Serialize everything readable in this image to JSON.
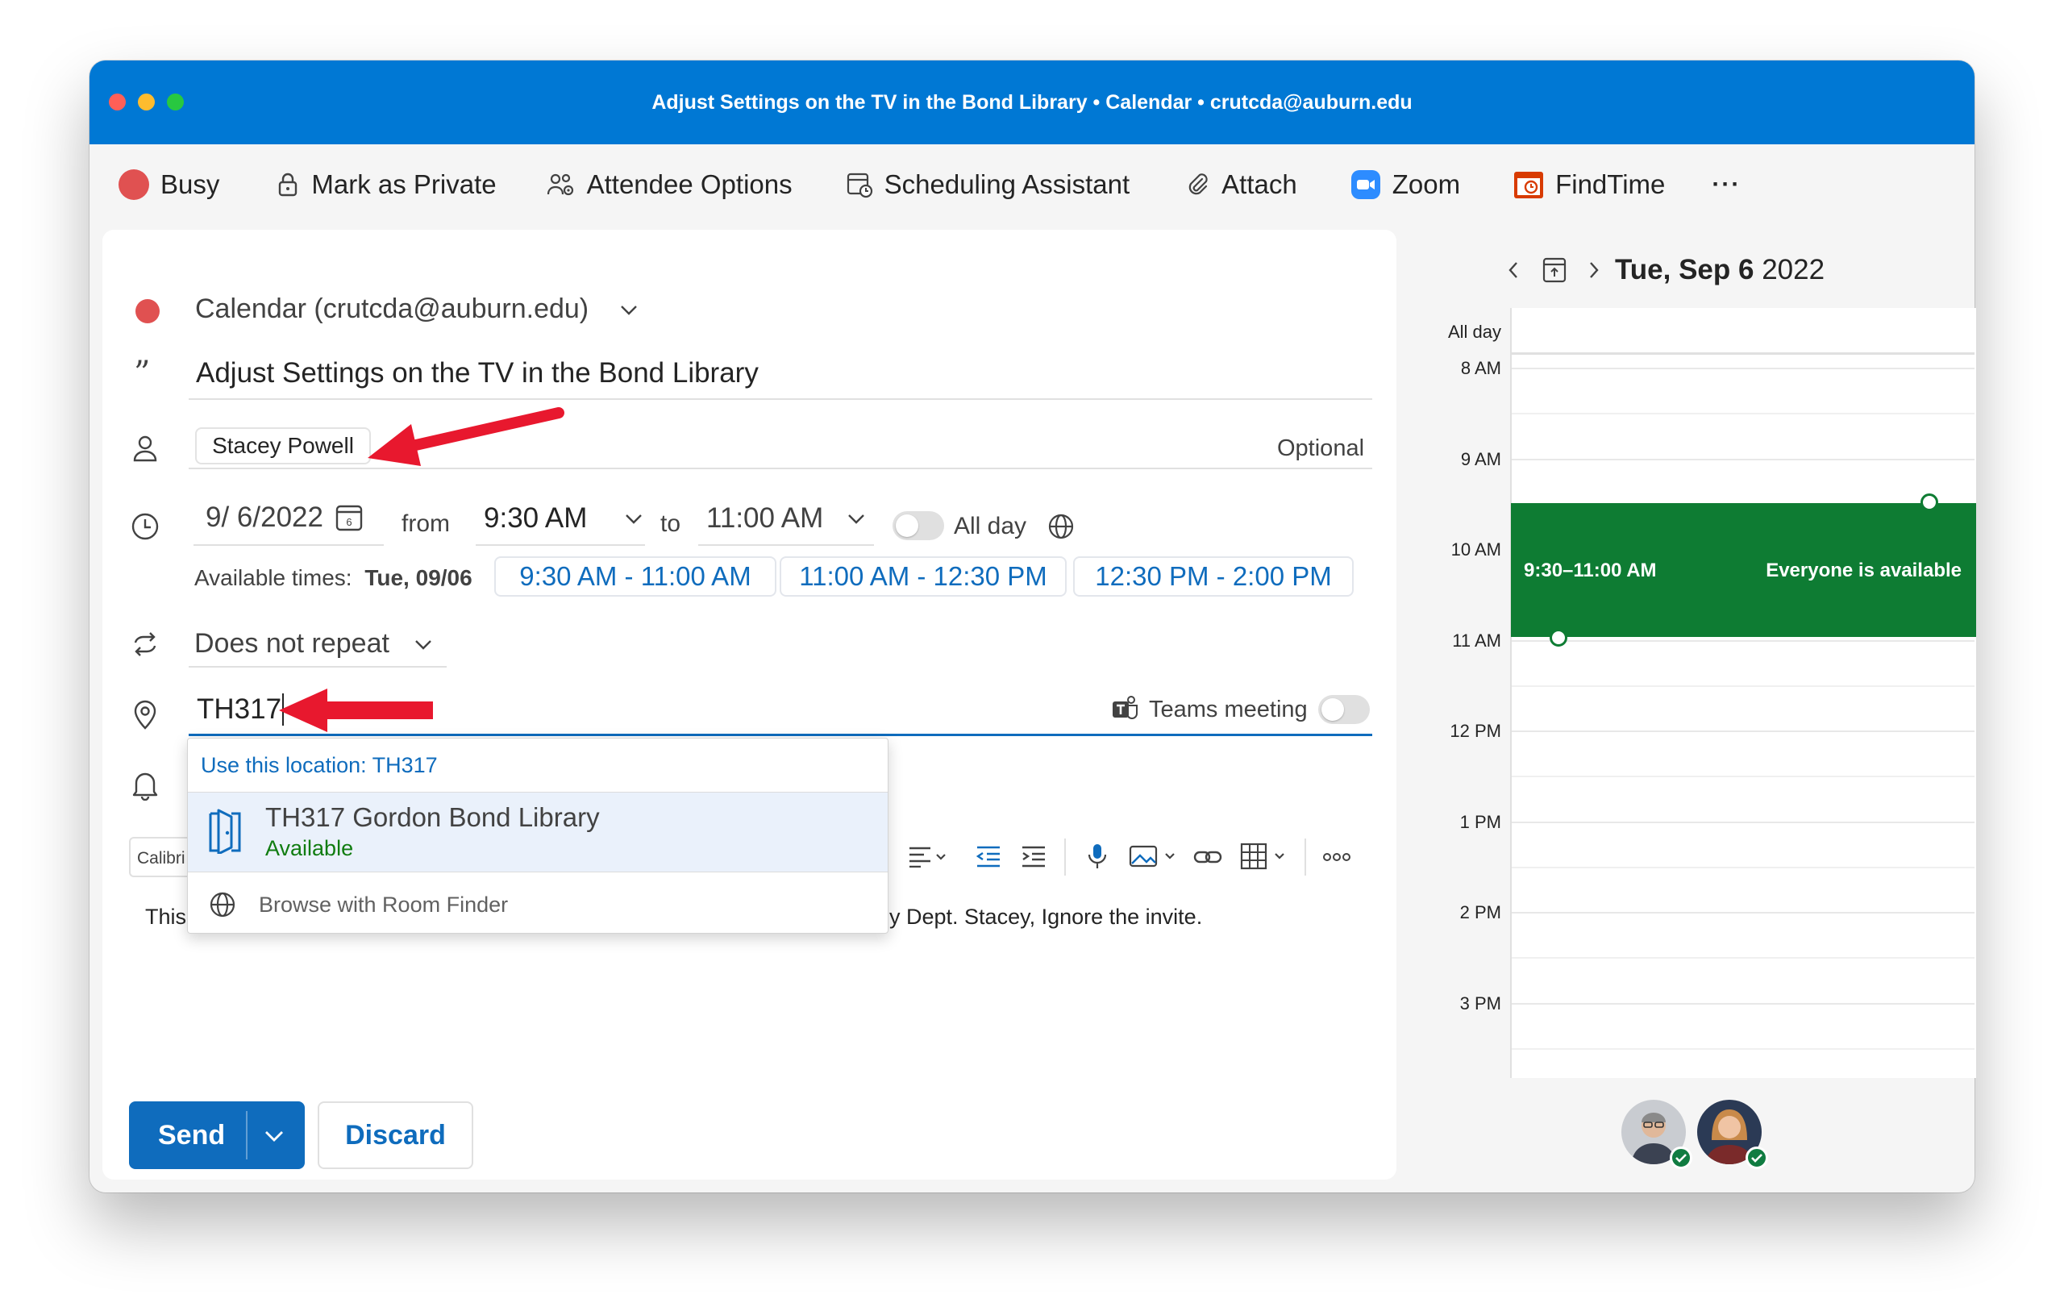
{
  "window": {
    "title": "Adjust Settings on the TV in the Bond Library • Calendar • crutcda@auburn.edu"
  },
  "toolbar": {
    "busy": "Busy",
    "private": "Mark as Private",
    "attendee_options": "Attendee Options",
    "scheduling": "Scheduling Assistant",
    "attach": "Attach",
    "zoom": "Zoom",
    "findtime": "FindTime",
    "more": "···"
  },
  "form": {
    "calendar": "Calendar (crutcda@auburn.edu)",
    "subject": "Adjust Settings on the TV in the Bond Library",
    "attendee": "Stacey Powell",
    "optional": "Optional",
    "date": "9/ 6/2022",
    "from": "from",
    "start_time": "9:30 AM",
    "to": "to",
    "end_time": "11:00 AM",
    "all_day": "All day",
    "available_label": "Available times:",
    "available_date": "Tue, 09/06",
    "slots": [
      "9:30 AM - 11:00 AM",
      "11:00 AM - 12:30 PM",
      "12:30 PM - 2:00 PM"
    ],
    "repeat": "Does not repeat",
    "location": "TH317",
    "teams": "Teams meeting",
    "font": "Calibri",
    "body_start": "This",
    "body_end": "y Dept. Stacey, Ignore the invite."
  },
  "location_menu": {
    "use_location": "Use this location: TH317",
    "room_name": "TH317 Gordon Bond Library",
    "room_status": "Available",
    "browse": "Browse with Room Finder"
  },
  "actions": {
    "send": "Send",
    "discard": "Discard"
  },
  "calendar": {
    "date_bold": "Tue, Sep 6",
    "year": " 2022",
    "all_day": "All day",
    "hours": [
      "8 AM",
      "9 AM",
      "10 AM",
      "11 AM",
      "12 PM",
      "1 PM",
      "2 PM",
      "3 PM"
    ],
    "event_time": "9:30–11:00 AM",
    "event_status": "Everyone is available"
  },
  "colors": {
    "titlebar": "#0078d4",
    "accent": "#0f6cbd",
    "event": "#0e7c33",
    "busy": "#e05151",
    "arrow": "#e8182e"
  }
}
